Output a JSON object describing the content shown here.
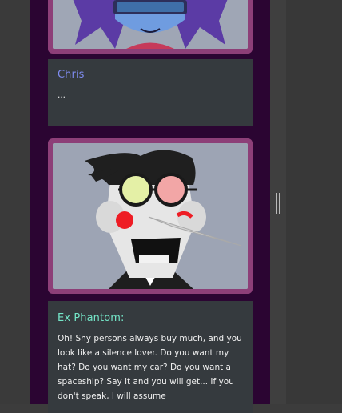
{
  "colors": {
    "chris_name": "#7f8cf0",
    "phantom_name": "#74e6c8",
    "message_text": "#f0f0f0",
    "frame": "#8d3f78",
    "column_bg": "#2b0532",
    "card_bg": "#353a3e"
  },
  "messages": [
    {
      "speaker": "Chris",
      "text": "...",
      "portrait_icon": "kris-portrait-icon"
    },
    {
      "speaker": "Ex Phantom:",
      "text": "Oh! Shy persons always buy much, and you look like a silence lover. Do you want my hat? Do you want my car? Do you want a spaceship? Say it and you will get... If you don't speak, I will assume",
      "portrait_icon": "spamton-portrait-icon"
    }
  ]
}
